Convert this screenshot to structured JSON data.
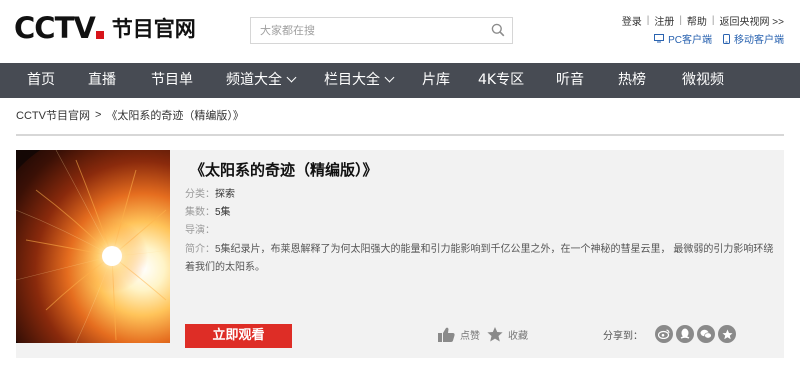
{
  "header": {
    "logo_main": "CCTV",
    "logo_sub": "节目官网",
    "search_placeholder": "大家都在搜",
    "top_links": [
      "登录",
      "注册",
      "帮助",
      "返回央视网 >>"
    ],
    "client_links": [
      {
        "label": "PC客户端",
        "icon": "monitor-icon"
      },
      {
        "label": "移动客户端",
        "icon": "phone-icon"
      }
    ]
  },
  "nav": {
    "items": [
      {
        "label": "首页",
        "dropdown": false
      },
      {
        "label": "直播",
        "dropdown": false
      },
      {
        "label": "节目单",
        "dropdown": false
      },
      {
        "label": "频道大全",
        "dropdown": true
      },
      {
        "label": "栏目大全",
        "dropdown": true
      },
      {
        "label": "片库",
        "dropdown": false
      },
      {
        "label": "4K专区",
        "dropdown": false
      },
      {
        "label": "听音",
        "dropdown": false
      },
      {
        "label": "热榜",
        "dropdown": false
      },
      {
        "label": "微视频",
        "dropdown": false
      }
    ]
  },
  "breadcrumb": {
    "home": "CCTV节目官网",
    "separator": ">",
    "current": "《太阳系的奇迹（精编版）》"
  },
  "program": {
    "title": "《太阳系的奇迹（精编版）》",
    "category_label": "分类：",
    "category": "探索",
    "episodes_label": "集数：",
    "episodes": "5集",
    "director_label": "导演：",
    "director": "",
    "intro_label": "简介：",
    "intro": "5集纪录片，布莱恩解释了为何太阳强大的能量和引力能影响到千亿公里之外，在一个神秘的彗星云里， 最微弱的引力影响环绕着我们的太阳系。",
    "watch_label": "立即观看",
    "like_label": "点赞",
    "favorite_label": "收藏",
    "share_label": "分享到："
  },
  "colors": {
    "nav_bg": "#474b53",
    "accent_red": "#de2d26",
    "link_blue": "#2a63b0",
    "card_bg": "#f2f2f2"
  }
}
